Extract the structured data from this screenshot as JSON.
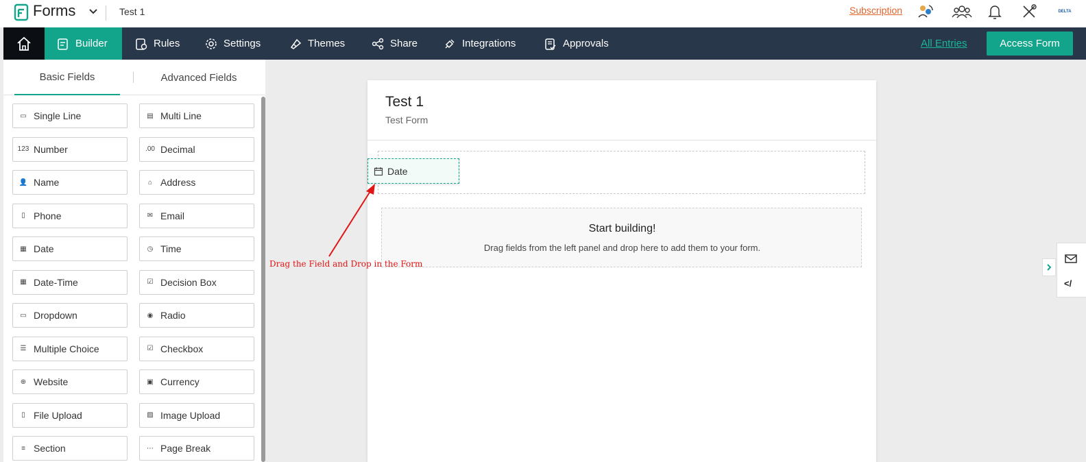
{
  "header": {
    "app_name": "Forms",
    "form_title": "Test 1",
    "subscription_label": "Subscription",
    "brand_text": "DELTA"
  },
  "nav": {
    "tabs": [
      {
        "label": "Builder",
        "icon": "builder-icon"
      },
      {
        "label": "Rules",
        "icon": "rules-icon"
      },
      {
        "label": "Settings",
        "icon": "gear-icon"
      },
      {
        "label": "Themes",
        "icon": "themes-icon"
      },
      {
        "label": "Share",
        "icon": "share-icon"
      },
      {
        "label": "Integrations",
        "icon": "integrations-icon"
      },
      {
        "label": "Approvals",
        "icon": "approvals-icon"
      }
    ],
    "all_entries_label": "All Entries",
    "access_form_label": "Access Form"
  },
  "panel": {
    "tabs": [
      "Basic Fields",
      "Advanced Fields"
    ],
    "fields": [
      {
        "label": "Single Line",
        "icon": "▭"
      },
      {
        "label": "Multi Line",
        "icon": "▤"
      },
      {
        "label": "Number",
        "icon": "123"
      },
      {
        "label": "Decimal",
        "icon": ".00"
      },
      {
        "label": "Name",
        "icon": "👤"
      },
      {
        "label": "Address",
        "icon": "⌂"
      },
      {
        "label": "Phone",
        "icon": "▯"
      },
      {
        "label": "Email",
        "icon": "✉"
      },
      {
        "label": "Date",
        "icon": "▦"
      },
      {
        "label": "Time",
        "icon": "◷"
      },
      {
        "label": "Date-Time",
        "icon": "▦"
      },
      {
        "label": "Decision Box",
        "icon": "☑"
      },
      {
        "label": "Dropdown",
        "icon": "▭"
      },
      {
        "label": "Radio",
        "icon": "◉"
      },
      {
        "label": "Multiple Choice",
        "icon": "☰"
      },
      {
        "label": "Checkbox",
        "icon": "☑"
      },
      {
        "label": "Website",
        "icon": "⊕"
      },
      {
        "label": "Currency",
        "icon": "▣"
      },
      {
        "label": "File Upload",
        "icon": "▯"
      },
      {
        "label": "Image Upload",
        "icon": "▨"
      },
      {
        "label": "Section",
        "icon": "≡"
      },
      {
        "label": "Page Break",
        "icon": "⋯"
      }
    ]
  },
  "canvas": {
    "form_title": "Test 1",
    "form_description": "Test Form",
    "dragged_field_label": "Date",
    "start_title": "Start building!",
    "start_description": "Drag fields from the left panel and drop here to add them to your form."
  },
  "annotation": {
    "text": "Drag the Field and Drop in the Form",
    "color": "#e01515"
  },
  "side": {
    "code_label": "</"
  },
  "colors": {
    "accent": "#13a58b",
    "navbar": "#29374b",
    "subscription": "#e0662e"
  }
}
